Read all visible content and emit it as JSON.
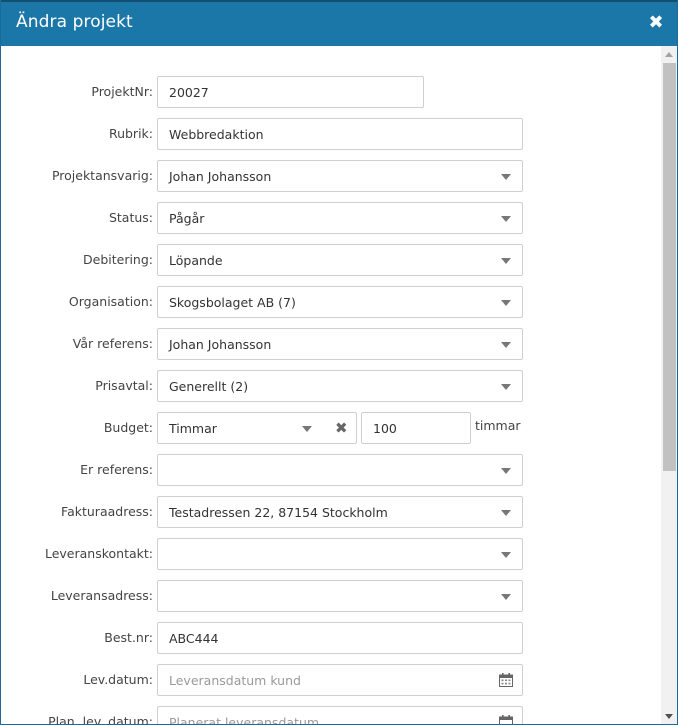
{
  "dialog": {
    "title": "Ändra projekt",
    "close_glyph": "✖"
  },
  "form": {
    "projektnr": {
      "label": "ProjektNr:",
      "value": "20027"
    },
    "rubrik": {
      "label": "Rubrik:",
      "value": "Webbredaktion"
    },
    "projektansvarig": {
      "label": "Projektansvarig:",
      "value": "Johan Johansson"
    },
    "status": {
      "label": "Status:",
      "value": "Pågår"
    },
    "debitering": {
      "label": "Debitering:",
      "value": "Löpande"
    },
    "organisation": {
      "label": "Organisation:",
      "value": "Skogsbolaget AB (7)"
    },
    "var_referens": {
      "label": "Vår referens:",
      "value": "Johan Johansson"
    },
    "prisavtal": {
      "label": "Prisavtal:",
      "value": "Generellt (2)"
    },
    "budget": {
      "label": "Budget:",
      "type_value": "Timmar",
      "clear_glyph": "✖",
      "amount": "100",
      "unit": "timmar"
    },
    "er_referens": {
      "label": "Er referens:",
      "value": ""
    },
    "fakturaadress": {
      "label": "Fakturaadress:",
      "value": "Testadressen 22, 87154 Stockholm"
    },
    "leveranskontakt": {
      "label": "Leveranskontakt:",
      "value": ""
    },
    "leveransadress": {
      "label": "Leveransadress:",
      "value": ""
    },
    "best_nr": {
      "label": "Best.nr:",
      "value": "ABC444"
    },
    "lev_datum": {
      "label": "Lev.datum:",
      "placeholder": "Leveransdatum kund"
    },
    "plan_lev_datum": {
      "label": "Plan. lev. datum:",
      "placeholder": "Planerat leveransdatum"
    }
  }
}
